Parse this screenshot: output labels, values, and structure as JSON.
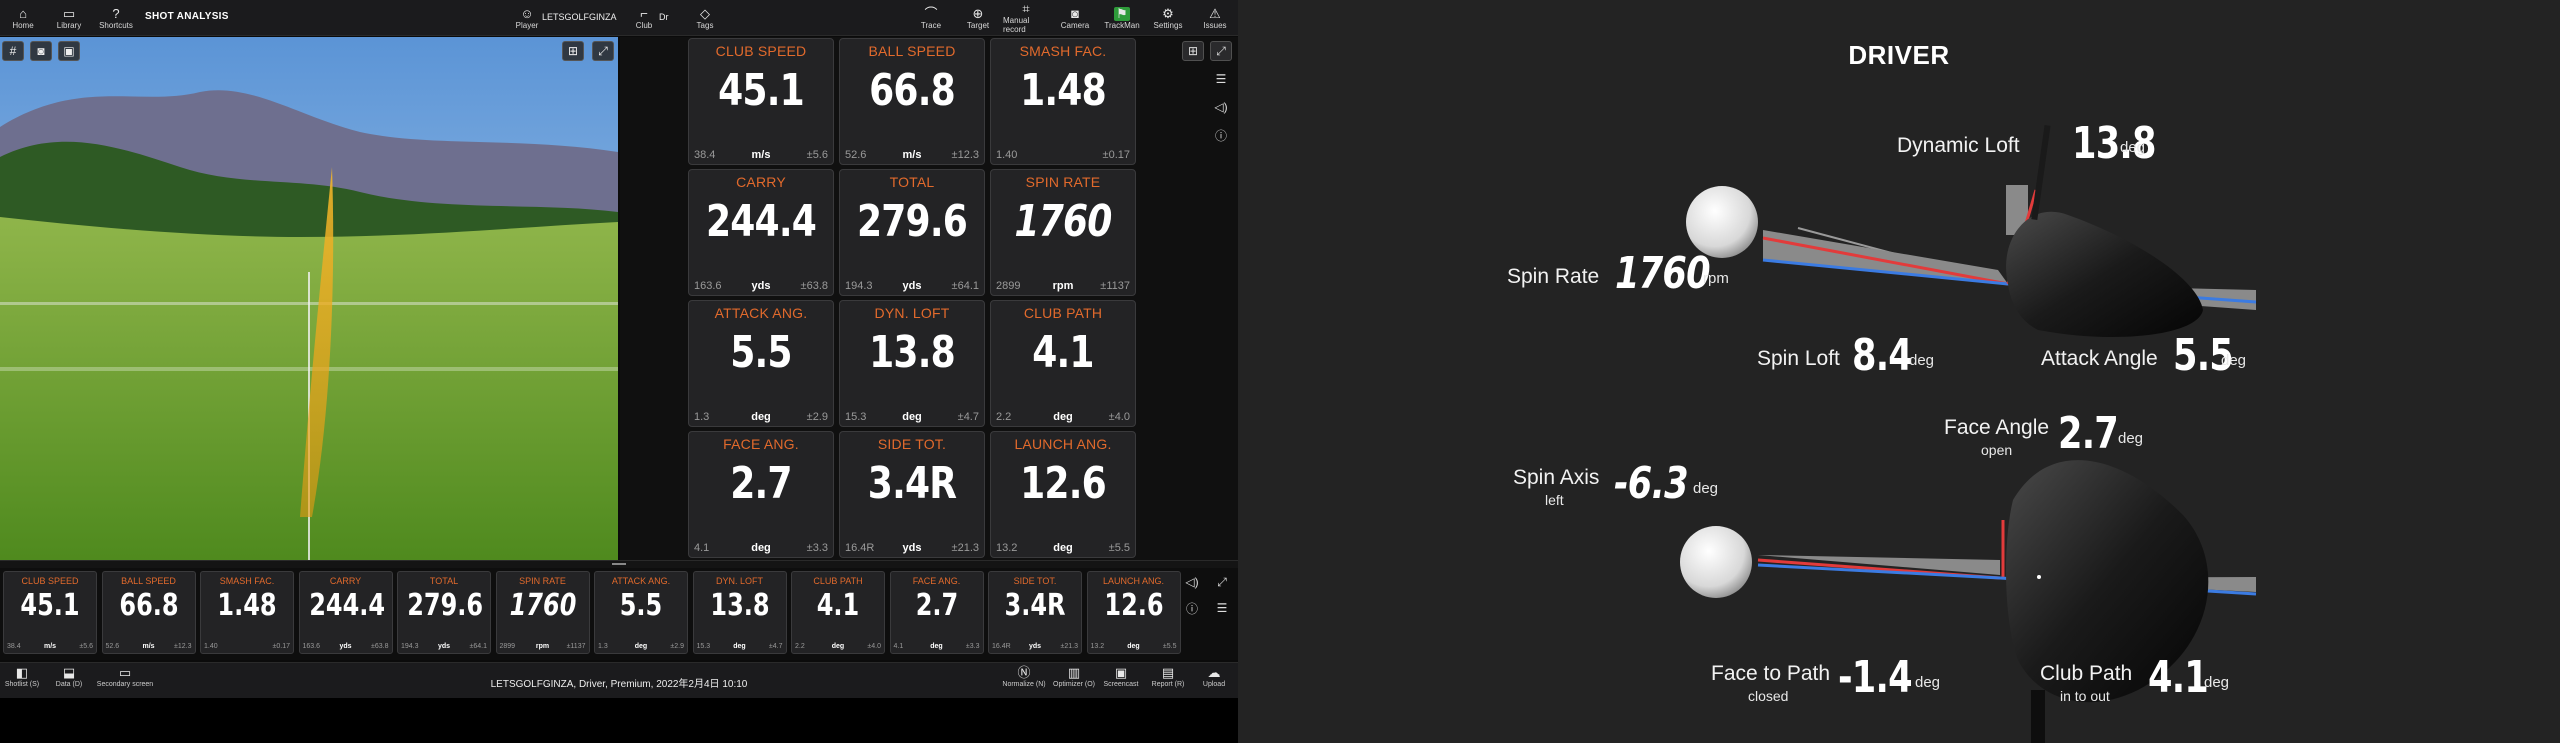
{
  "topbar": {
    "home": "Home",
    "library": "Library",
    "shortcuts": "Shortcuts",
    "title": "SHOT ANALYSIS",
    "player_name": "LETSGOLFGINZA",
    "player_label": "Player",
    "club_value": "Dr",
    "club_label": "Club",
    "tags": "Tags",
    "trace": "Trace",
    "target": "Target",
    "manual_record": "Manual record",
    "camera": "Camera",
    "trackman": "TrackMan",
    "settings": "Settings",
    "issues": "Issues"
  },
  "tiles": [
    {
      "label": "CLUB SPEED",
      "value": "45.1",
      "min": "38.4",
      "unit": "m/s",
      "dev": "±5.6"
    },
    {
      "label": "BALL SPEED",
      "value": "66.8",
      "min": "52.6",
      "unit": "m/s",
      "dev": "±12.3"
    },
    {
      "label": "SMASH FAC.",
      "value": "1.48",
      "min": "1.40",
      "unit": "",
      "dev": "±0.17"
    },
    {
      "label": "CARRY",
      "value": "244.4",
      "min": "163.6",
      "unit": "yds",
      "dev": "±63.8"
    },
    {
      "label": "TOTAL",
      "value": "279.6",
      "min": "194.3",
      "unit": "yds",
      "dev": "±64.1"
    },
    {
      "label": "SPIN RATE",
      "value": "1760",
      "min": "2899",
      "unit": "rpm",
      "dev": "±1137"
    },
    {
      "label": "ATTACK ANG.",
      "value": "5.5",
      "min": "1.3",
      "unit": "deg",
      "dev": "±2.9"
    },
    {
      "label": "DYN. LOFT",
      "value": "13.8",
      "min": "15.3",
      "unit": "deg",
      "dev": "±4.7"
    },
    {
      "label": "CLUB PATH",
      "value": "4.1",
      "min": "2.2",
      "unit": "deg",
      "dev": "±4.0"
    },
    {
      "label": "FACE ANG.",
      "value": "2.7",
      "min": "4.1",
      "unit": "deg",
      "dev": "±3.3"
    },
    {
      "label": "SIDE TOT.",
      "value": "3.4R",
      "min": "16.4R",
      "unit": "yds",
      "dev": "±21.3"
    },
    {
      "label": "LAUNCH ANG.",
      "value": "12.6",
      "min": "13.2",
      "unit": "deg",
      "dev": "±5.5"
    }
  ],
  "footer": {
    "shotlist": "Shotlist (S)",
    "data": "Data (D)",
    "secondary": "Secondary screen",
    "session_info": "LETSGOLFGINZA, Driver, Premium, 2022年2月4日 10:10",
    "normalize": "Normalize (N)",
    "optimizer": "Optimizer (O)",
    "screencast": "Screencast",
    "report": "Report (R)",
    "upload": "Upload"
  },
  "driver_panel": {
    "title": "DRIVER",
    "dynamic_loft": {
      "label": "Dynamic Loft",
      "value": "13.8",
      "unit": "deg"
    },
    "spin_rate": {
      "label": "Spin Rate",
      "value": "1760",
      "unit": "rpm"
    },
    "spin_loft": {
      "label": "Spin Loft",
      "value": "8.4",
      "unit": "deg"
    },
    "attack_angle": {
      "label": "Attack Angle",
      "value": "5.5",
      "unit": "deg"
    },
    "face_angle": {
      "label": "Face Angle",
      "value": "2.7",
      "unit": "deg",
      "sub": "open"
    },
    "spin_axis": {
      "label": "Spin Axis",
      "value": "-6.3",
      "unit": "deg",
      "sub": "left"
    },
    "face_to_path": {
      "label": "Face to Path",
      "value": "-1.4",
      "unit": "deg",
      "sub": "closed"
    },
    "club_path": {
      "label": "Club Path",
      "value": "4.1",
      "unit": "deg",
      "sub": "in to out"
    }
  },
  "colors": {
    "accent": "#e26a2c",
    "tile_bg": "#232325",
    "red_line": "#e23b3b",
    "blue_line": "#3b7be2"
  }
}
